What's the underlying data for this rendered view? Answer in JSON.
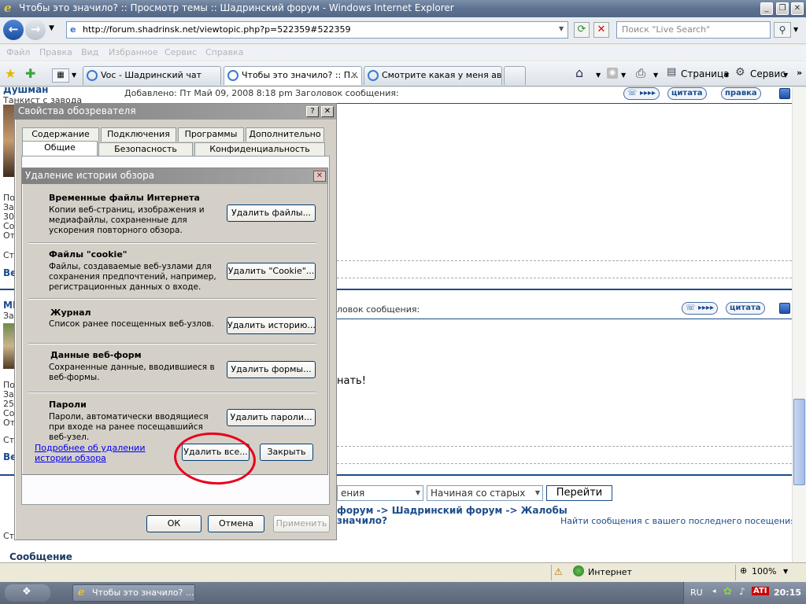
{
  "window": {
    "title": "Чтобы это значило? :: Просмотр темы :: Шадринский форум - Windows Internet Explorer"
  },
  "nav": {
    "url": "http://forum.shadrinsk.net/viewtopic.php?p=522359#522359",
    "search_placeholder": "Поиск \"Live Search\""
  },
  "menu": [
    "Файл",
    "Правка",
    "Вид",
    "Избранное",
    "Сервис",
    "Справка"
  ],
  "tabs": [
    {
      "label": "Voc - Шадринский чат"
    },
    {
      "label": "Чтобы это значило? :: П..."
    },
    {
      "label": "Смотрите какая у меня ава..."
    }
  ],
  "command_bar": {
    "page_label": "Страница",
    "tools_label": "Сервис"
  },
  "forum": {
    "post1": {
      "author": "Душман",
      "rank": "Танкист с завода",
      "meta": "Добавлено: Пт Май 09, 2008 8:18 pm   Заголовок сообщения:",
      "quote_label": "цитата",
      "edit_label": "правка"
    },
    "post2": {
      "author_fragment": "MI",
      "meta_fragment": "ловок сообщения:",
      "quote_label": "цитата",
      "body_fragment": "нать!"
    },
    "left_fragments": {
      "p1": "По",
      "p2": "За",
      "p3": "30",
      "p4": "Со",
      "p5": "От",
      "p6": "Ст",
      "p7": "Ве",
      "p8": "За",
      "p9": "По",
      "p10": "За",
      "p11": "25",
      "p12": "Со",
      "p13": "От",
      "p14": "Ст",
      "p15": "Ве",
      "p16": "Ст",
      "p17": "Сообщение"
    },
    "sort_select": "ения",
    "order_select": "Начиная со старых",
    "go_button": "Перейти",
    "breadcrumb_line1": "форум -> Шадринский форум -> Жалобы",
    "breadcrumb_line2": "значило?",
    "find_link": "Найти сообщения с вашего последнего посещения"
  },
  "options_dialog": {
    "title": "Свойства обозревателя",
    "tabs_row1": [
      "Содержание",
      "Подключения",
      "Программы",
      "Дополнительно"
    ],
    "tabs_row2": [
      "Общие",
      "Безопасность",
      "Конфиденциальность"
    ],
    "ok": "ОК",
    "cancel": "Отмена",
    "apply": "Применить"
  },
  "delete_dialog": {
    "title": "Удаление истории обзора",
    "sections": [
      {
        "title": "Временные файлы Интернета",
        "desc": "Копии веб-страниц, изображения и медиафайлы, сохраненные для ускорения повторного обзора.",
        "button": "Удалить файлы..."
      },
      {
        "title": "Файлы \"cookie\"",
        "desc": "Файлы, создаваемые веб-узлами для сохранения предпочтений, например, регистрационных данных о входе.",
        "button": "Удалить \"Cookie\"..."
      },
      {
        "title": "Журнал",
        "desc": "Список ранее посещенных веб-узлов.",
        "button": "Удалить историю..."
      },
      {
        "title": "Данные веб-форм",
        "desc": "Сохраненные данные, вводившиеся в веб-формы.",
        "button": "Удалить формы..."
      },
      {
        "title": "Пароли",
        "desc": "Пароли, автоматически вводящиеся при входе на ранее посещавшийся веб-узел.",
        "button": "Удалить пароли..."
      }
    ],
    "more_link": "Подробнее об удалении истории обзора",
    "delete_all": "Удалить все...",
    "close": "Закрыть"
  },
  "status": {
    "zone": "Интернет",
    "zoom": "100%"
  },
  "taskbar": {
    "item": "Чтобы это значило? ...",
    "lang": "RU",
    "clock": "20:15"
  },
  "colors": {
    "accent_blue": "#1c4c8c",
    "highlight_red": "#e8001c"
  }
}
